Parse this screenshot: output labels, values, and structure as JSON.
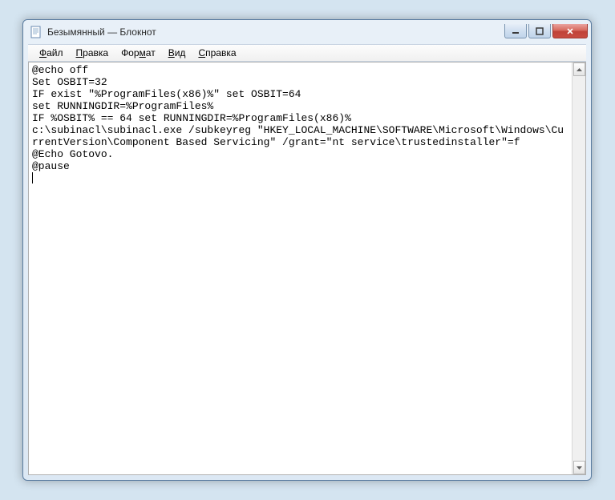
{
  "window": {
    "title": "Безымянный — Блокнот"
  },
  "menu": {
    "file": "Файл",
    "edit": "Правка",
    "format": "Формат",
    "view": "Вид",
    "help": "Справка"
  },
  "editor": {
    "content": "@echo off\nSet OSBIT=32\nIF exist \"%ProgramFiles(x86)%\" set OSBIT=64\nset RUNNINGDIR=%ProgramFiles%\nIF %OSBIT% == 64 set RUNNINGDIR=%ProgramFiles(x86)%\nc:\\subinacl\\subinacl.exe /subkeyreg \"HKEY_LOCAL_MACHINE\\SOFTWARE\\Microsoft\\Windows\\CurrentVersion\\Component Based Servicing\" /grant=\"nt service\\trustedinstaller\"=f\n@Echo Gotovo.\n@pause"
  }
}
